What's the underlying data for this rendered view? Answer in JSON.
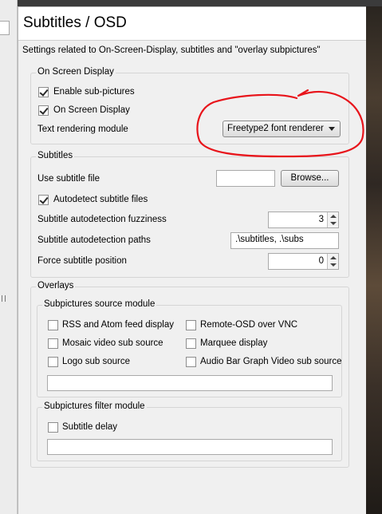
{
  "page": {
    "title": "Subtitles / OSD",
    "description": "Settings related to On-Screen-Display, subtitles and \"overlay subpictures\""
  },
  "osd": {
    "legend": "On Screen Display",
    "enable_subpictures": {
      "label": "Enable sub-pictures",
      "checked": true
    },
    "on_screen_display": {
      "label": "On Screen Display",
      "checked": true
    },
    "text_rendering": {
      "label": "Text rendering module",
      "value": "Freetype2 font renderer"
    }
  },
  "subtitles": {
    "legend": "Subtitles",
    "use_file": {
      "label": "Use subtitle file",
      "value": "",
      "browse": "Browse..."
    },
    "autodetect": {
      "label": "Autodetect subtitle files",
      "checked": true
    },
    "fuzziness": {
      "label": "Subtitle autodetection fuzziness",
      "value": "3"
    },
    "paths": {
      "label": "Subtitle autodetection paths",
      "value": ".\\subtitles, .\\subs"
    },
    "force_position": {
      "label": "Force subtitle position",
      "value": "0"
    }
  },
  "overlays": {
    "legend": "Overlays",
    "source": {
      "legend": "Subpictures source module",
      "items": [
        {
          "label": "RSS and Atom feed display",
          "checked": false
        },
        {
          "label": "Remote-OSD over VNC",
          "checked": false
        },
        {
          "label": "Mosaic video sub source",
          "checked": false
        },
        {
          "label": "Marquee display",
          "checked": false
        },
        {
          "label": "Logo sub source",
          "checked": false
        },
        {
          "label": "Audio Bar Graph Video sub source",
          "checked": false
        }
      ],
      "text_value": ""
    },
    "filter": {
      "legend": "Subpictures filter module",
      "items": [
        {
          "label": "Subtitle delay",
          "checked": false
        }
      ],
      "text_value": ""
    }
  },
  "colors": {
    "panel_bg": "#f0f0f0",
    "annotation": "#e8141b"
  }
}
